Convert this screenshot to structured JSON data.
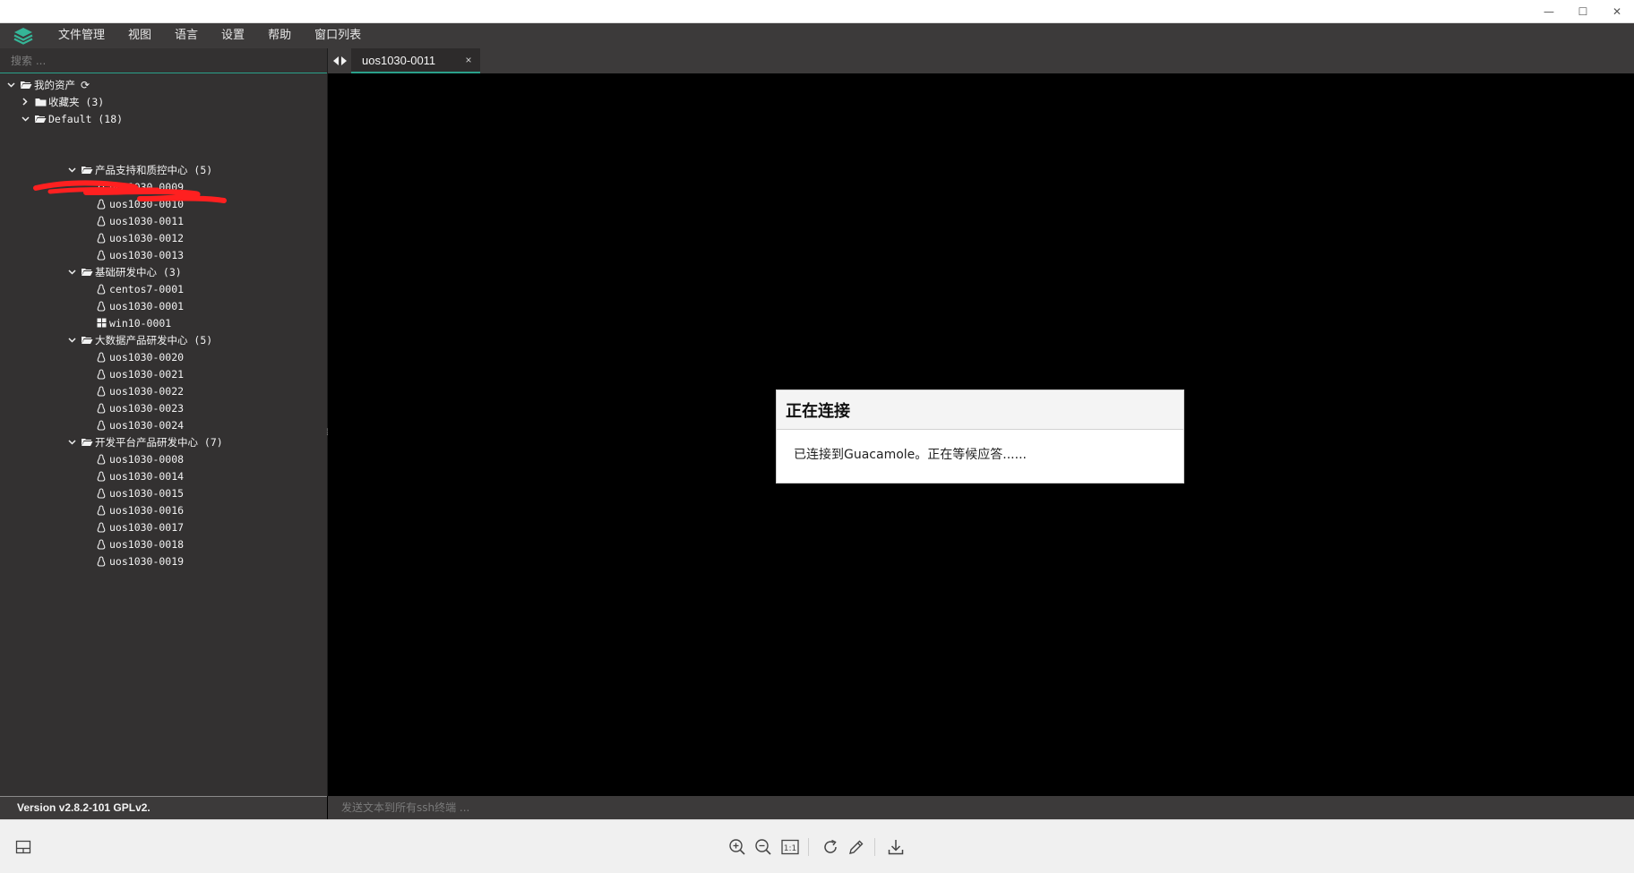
{
  "window": {
    "minimize_glyph": "—",
    "maximize_glyph": "☐",
    "close_glyph": "✕"
  },
  "menu": {
    "items": [
      "文件管理",
      "视图",
      "语言",
      "设置",
      "帮助",
      "窗口列表"
    ]
  },
  "sidebar": {
    "search_placeholder": "搜索 ...",
    "root": "我的资产",
    "favorites": "收藏夹 (3)",
    "default_group": "Default (18)",
    "groups": [
      {
        "label": "产品支持和质控中心 (5)",
        "items": [
          "uos1030-0009",
          "uos1030-0010",
          "uos1030-0011",
          "uos1030-0012",
          "uos1030-0013"
        ]
      },
      {
        "label": "基础研发中心 (3)",
        "items": [
          "centos7-0001",
          "uos1030-0001",
          "win10-0001"
        ]
      },
      {
        "label": "大数据产品研发中心 (5)",
        "items": [
          "uos1030-0020",
          "uos1030-0021",
          "uos1030-0022",
          "uos1030-0023",
          "uos1030-0024"
        ]
      },
      {
        "label": "开发平台产品研发中心 (7)",
        "items": [
          "uos1030-0008",
          "uos1030-0014",
          "uos1030-0015",
          "uos1030-0016",
          "uos1030-0017",
          "uos1030-0018",
          "uos1030-0019"
        ]
      }
    ]
  },
  "tabs": {
    "active": "uos1030-0011",
    "close_glyph": "×"
  },
  "dialog": {
    "title": "正在连接",
    "message": "已连接到Guacamole。正在等候应答......"
  },
  "status": {
    "version": "Version v2.8.2-101 GPLv2.",
    "broadcast_placeholder": "发送文本到所有ssh终端 ..."
  },
  "colors": {
    "accent": "#2aa18b",
    "panel": "#333131",
    "bar": "#3c3a3a"
  }
}
